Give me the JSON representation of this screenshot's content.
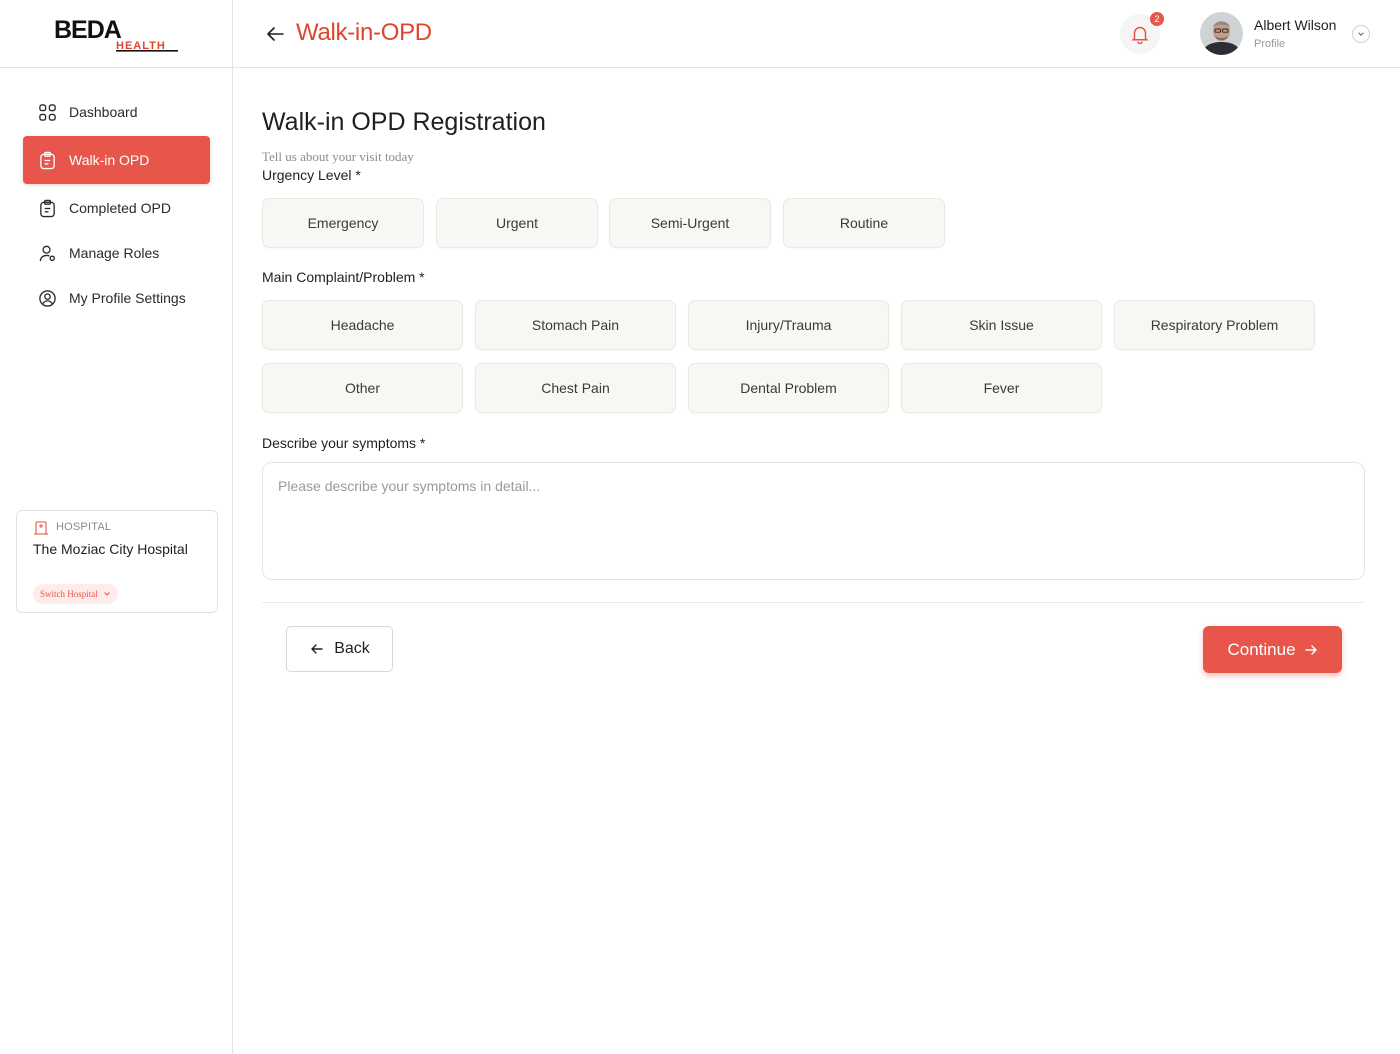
{
  "brand": {
    "logo_main": "BEDA",
    "logo_sub": "HEALTH",
    "accent": "#e8554a"
  },
  "sidebar": {
    "items": [
      {
        "label": "Dashboard",
        "icon": "grid-icon",
        "active": false
      },
      {
        "label": "Walk-in OPD",
        "icon": "clipboard-icon",
        "active": true
      },
      {
        "label": "Completed OPD",
        "icon": "clipboard-check-icon",
        "active": false
      },
      {
        "label": "Manage Roles",
        "icon": "user-gear-icon",
        "active": false
      },
      {
        "label": "My Profile Settings",
        "icon": "user-circle-icon",
        "active": false
      }
    ],
    "hospital": {
      "tag": "HOSPITAL",
      "name": "The Moziac City Hospital",
      "switch_label": "Switch Hospital"
    }
  },
  "header": {
    "title": "Walk-in-OPD",
    "notification_count": "2",
    "user": {
      "name": "Albert Wilson",
      "role": "Profile"
    }
  },
  "form": {
    "title": "Walk-in OPD Registration",
    "subtitle": "Tell us about your visit today",
    "urgency_label": "Urgency Level *",
    "urgency_options": [
      "Emergency",
      "Urgent",
      "Semi-Urgent",
      "Routine"
    ],
    "complaint_label": "Main Complaint/Problem *",
    "complaint_options": [
      "Headache",
      "Stomach Pain",
      "Injury/Trauma",
      "Skin Issue",
      "Respiratory Problem",
      "Other",
      "Chest Pain",
      "Dental Problem",
      "Fever"
    ],
    "symptoms_label": "Describe your symptoms *",
    "symptoms_placeholder": "Please describe your symptoms in detail...",
    "symptoms_value": "",
    "back_label": "Back",
    "continue_label": "Continue"
  }
}
